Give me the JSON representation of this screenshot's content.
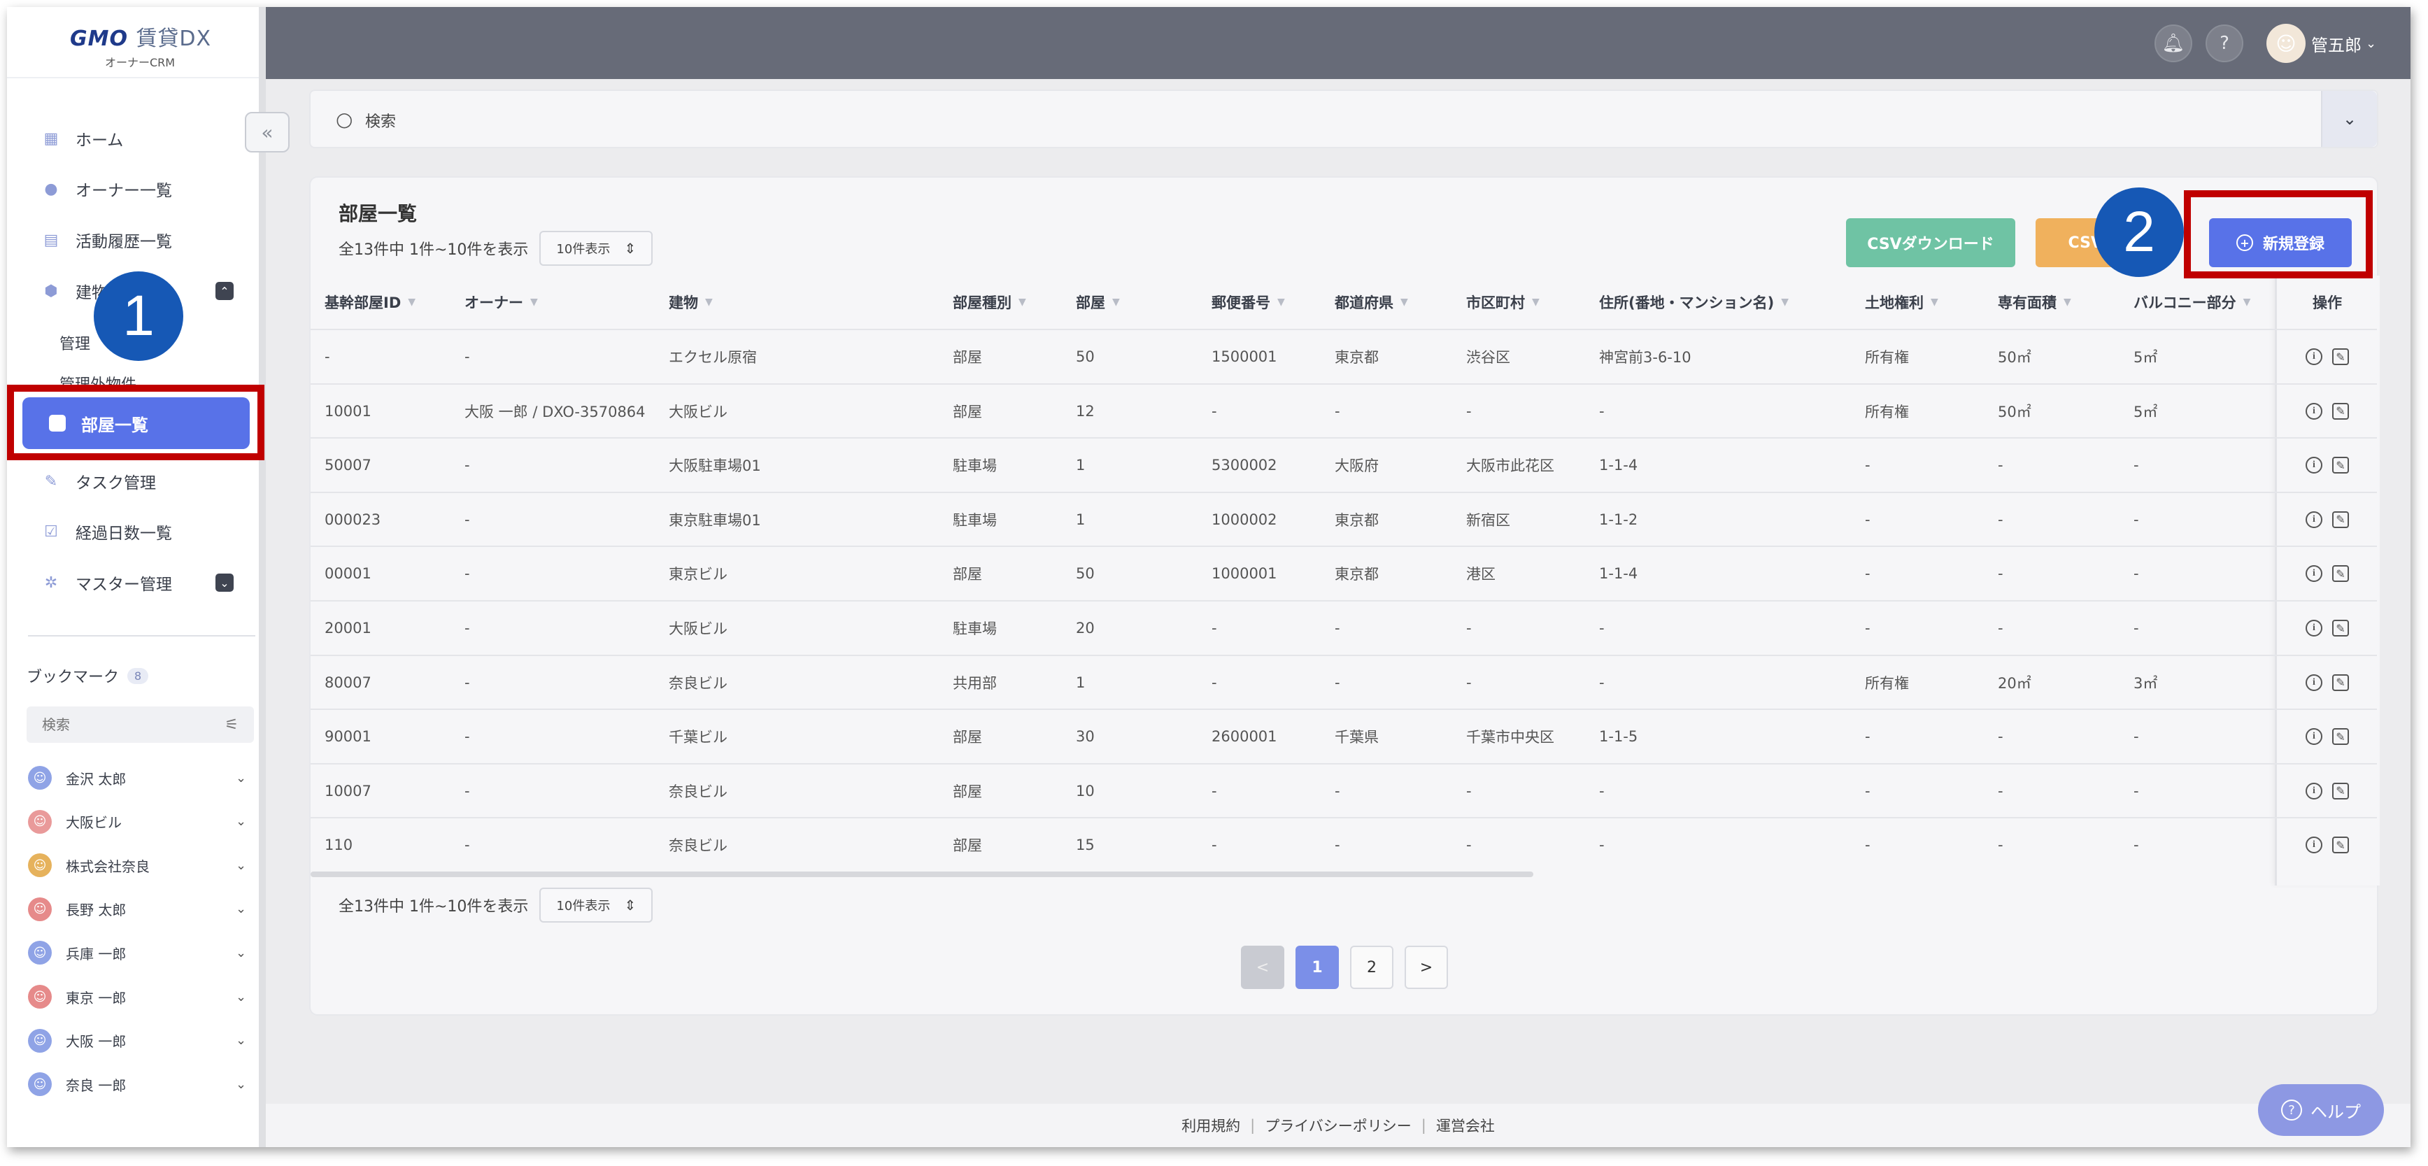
{
  "logo": {
    "brand": "GMO",
    "product": "賃貸DX",
    "sub": "オーナーCRM"
  },
  "sidebar": {
    "nav": [
      {
        "label": "ホーム",
        "icon": "home-icon"
      },
      {
        "label": "オーナー一覧",
        "icon": "user-icon"
      },
      {
        "label": "活動履歴一覧",
        "icon": "document-icon"
      },
      {
        "label": "建物",
        "icon": "building-icon"
      }
    ],
    "sub": [
      "管理",
      "管理外物件"
    ],
    "active": "部屋一覧",
    "nav2": [
      {
        "label": "タスク管理",
        "icon": "task-icon"
      },
      {
        "label": "経過日数一覧",
        "icon": "check-icon"
      },
      {
        "label": "マスター管理",
        "icon": "gear-icon"
      }
    ],
    "bookmark_title": "ブックマーク",
    "bookmark_count": "8",
    "bookmark_search_placeholder": "検索",
    "bookmarks": [
      {
        "name": "金沢 太郎",
        "color": "#8fa3e6"
      },
      {
        "name": "大阪ビル",
        "color": "#e99a9a"
      },
      {
        "name": "株式会社奈良",
        "color": "#e6b25c"
      },
      {
        "name": "長野 太郎",
        "color": "#e68a8a"
      },
      {
        "name": "兵庫 一郎",
        "color": "#8fa3e6"
      },
      {
        "name": "東京 一郎",
        "color": "#e68a8a"
      },
      {
        "name": "大阪 一郎",
        "color": "#8fa3e6"
      },
      {
        "name": "奈良 一郎",
        "color": "#8fa3e6"
      }
    ]
  },
  "header": {
    "user_name": "管五郎"
  },
  "search": {
    "placeholder": "検索"
  },
  "card": {
    "title": "部屋一覧",
    "count_text": "全13件中 1件~10件を表示",
    "per_page": "10件表示",
    "buttons": {
      "csv_download": "CSVダウンロード",
      "csv_upload": "CSV-",
      "new": "新規登録"
    }
  },
  "table": {
    "columns": [
      "基幹部屋ID",
      "オーナー",
      "建物",
      "部屋種別",
      "部屋",
      "郵便番号",
      "都道府県",
      "市区町村",
      "住所(番地・マンション名)",
      "土地権利",
      "専有面積",
      "バルコニー部分",
      "操作"
    ],
    "rows": [
      [
        "-",
        "-",
        "エクセル原宿",
        "部屋",
        "50",
        "1500001",
        "東京都",
        "渋谷区",
        "神宮前3-6-10",
        "所有権",
        "50㎡",
        "5㎡"
      ],
      [
        "10001",
        "大阪 一郎 / DXO-3570864",
        "大阪ビル",
        "部屋",
        "12",
        "-",
        "-",
        "-",
        "-",
        "所有権",
        "50㎡",
        "5㎡"
      ],
      [
        "50007",
        "-",
        "大阪駐車場01",
        "駐車場",
        "1",
        "5300002",
        "大阪府",
        "大阪市此花区",
        "1-1-4",
        "-",
        "-",
        "-"
      ],
      [
        "000023",
        "-",
        "東京駐車場01",
        "駐車場",
        "1",
        "1000002",
        "東京都",
        "新宿区",
        "1-1-2",
        "-",
        "-",
        "-"
      ],
      [
        "00001",
        "-",
        "東京ビル",
        "部屋",
        "50",
        "1000001",
        "東京都",
        "港区",
        "1-1-4",
        "-",
        "-",
        "-"
      ],
      [
        "20001",
        "-",
        "大阪ビル",
        "駐車場",
        "20",
        "-",
        "-",
        "-",
        "-",
        "-",
        "-",
        "-"
      ],
      [
        "80007",
        "-",
        "奈良ビル",
        "共用部",
        "1",
        "-",
        "-",
        "-",
        "-",
        "所有権",
        "20㎡",
        "3㎡"
      ],
      [
        "90001",
        "-",
        "千葉ビル",
        "部屋",
        "30",
        "2600001",
        "千葉県",
        "千葉市中央区",
        "1-1-5",
        "-",
        "-",
        "-"
      ],
      [
        "10007",
        "-",
        "奈良ビル",
        "部屋",
        "10",
        "-",
        "-",
        "-",
        "-",
        "-",
        "-",
        "-"
      ],
      [
        "110",
        "-",
        "奈良ビル",
        "部屋",
        "15",
        "-",
        "-",
        "-",
        "-",
        "-",
        "-",
        "-"
      ]
    ]
  },
  "pagination": {
    "prev": "<",
    "pages": [
      "1",
      "2"
    ],
    "next": ">"
  },
  "footer": {
    "links": [
      "利用規約",
      "プライバシーポリシー",
      "運営会社"
    ]
  },
  "help": {
    "label": "ヘルプ"
  },
  "annotations": {
    "step1": "1",
    "step2": "2"
  },
  "colors": {
    "primary": "#5872e8",
    "header": "#676b78",
    "csv_download": "#6fc3a4",
    "csv_upload": "#f0b15d",
    "highlight": "#c00000",
    "step_badge": "#1658b5"
  }
}
